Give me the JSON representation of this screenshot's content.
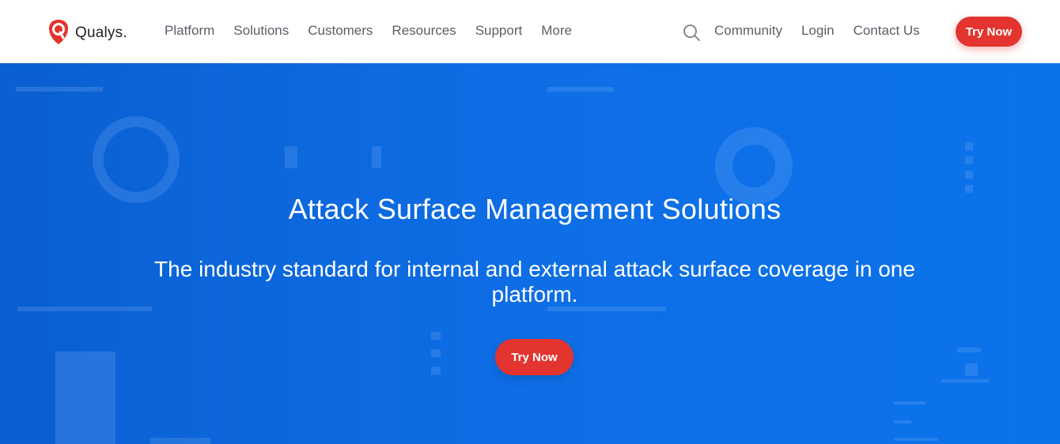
{
  "brand": {
    "name": "Qualys",
    "trademark_dot": ".",
    "color": "#e3342f"
  },
  "nav": {
    "menu": [
      "Platform",
      "Solutions",
      "Customers",
      "Resources",
      "Support",
      "More"
    ],
    "search_icon": "search-icon",
    "right_links": [
      "Community",
      "Login",
      "Contact Us"
    ],
    "cta_label": "Try Now"
  },
  "hero": {
    "title": "Attack Surface Management Solutions",
    "subtitle": "The industry standard for internal and external attack surface coverage in one platform.",
    "cta_label": "Try Now",
    "background_color": "#0e6ee6"
  }
}
